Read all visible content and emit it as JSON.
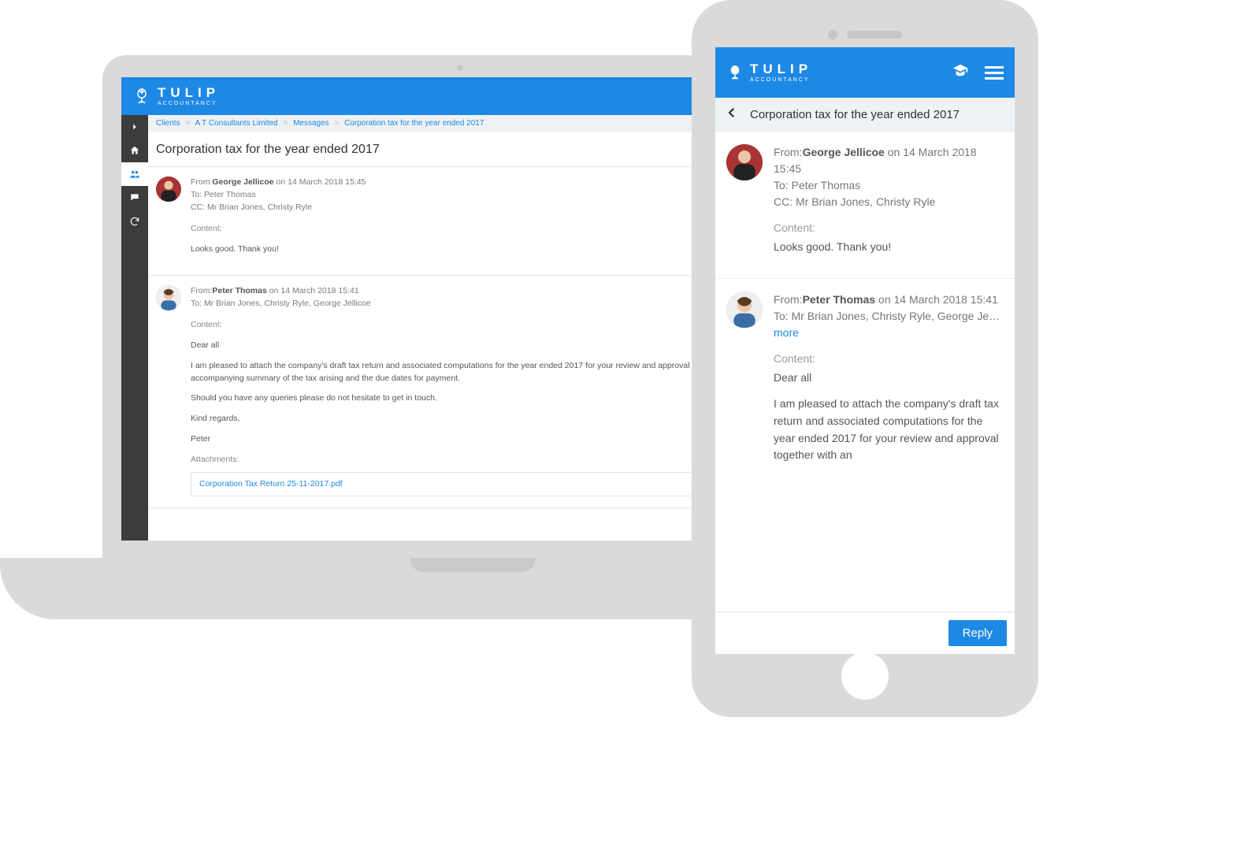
{
  "brand": {
    "name": "TULIP",
    "subtitle": "ACCOUNTANCY"
  },
  "breadcrumb": {
    "clients": "Clients",
    "client_name": "A T Consultants Limited",
    "messages": "Messages",
    "thread": "Corporation tax for the year ended 2017"
  },
  "page_title": "Corporation tax for the year ended 2017",
  "labels": {
    "from": "From:",
    "to": "To:",
    "cc": "CC:",
    "content": "Content:",
    "attachments": "Attachments:",
    "more": "more",
    "reply": "Reply",
    "on": "on"
  },
  "desktop_messages": [
    {
      "from_name": "George Jellicoe",
      "sent": "14 March 2018 15:45",
      "to": "Peter Thomas",
      "cc": "Mr Brian Jones, Christy Ryle",
      "body_lines": [
        "Looks good. Thank you!"
      ],
      "attachments": []
    },
    {
      "from_name": "Peter Thomas",
      "sent": "14 March 2018 15:41",
      "to": "Mr Brian Jones, Christy Ryle, George Jellicoe",
      "body_lines": [
        "Dear all",
        "I am pleased to attach the company's draft tax return and associated computations for the year ended 2017 for your review and approval together with an accompanying summary of the tax arising and the due dates for payment.",
        "Should you have any queries please do not hesitate to get in touch.",
        "Kind regards,",
        "Peter"
      ],
      "attachments": [
        "Corporation Tax Return 25-11-2017.pdf"
      ]
    }
  ],
  "mobile_messages": [
    {
      "from_name": "George Jellicoe",
      "sent": "14 March 2018 15:45",
      "to": "Peter Thomas",
      "cc": "Mr Brian Jones, Christy Ryle",
      "body_lines": [
        "Looks good. Thank you!"
      ]
    },
    {
      "from_name": "Peter Thomas",
      "sent": "14 March 2018 15:41",
      "to": "Mr Brian Jones, Christy Ryle, George Je…",
      "body_lines": [
        "Dear all",
        "I am pleased to attach the company's draft tax return and associated computations for the year ended 2017 for your review and approval together with an"
      ]
    }
  ]
}
